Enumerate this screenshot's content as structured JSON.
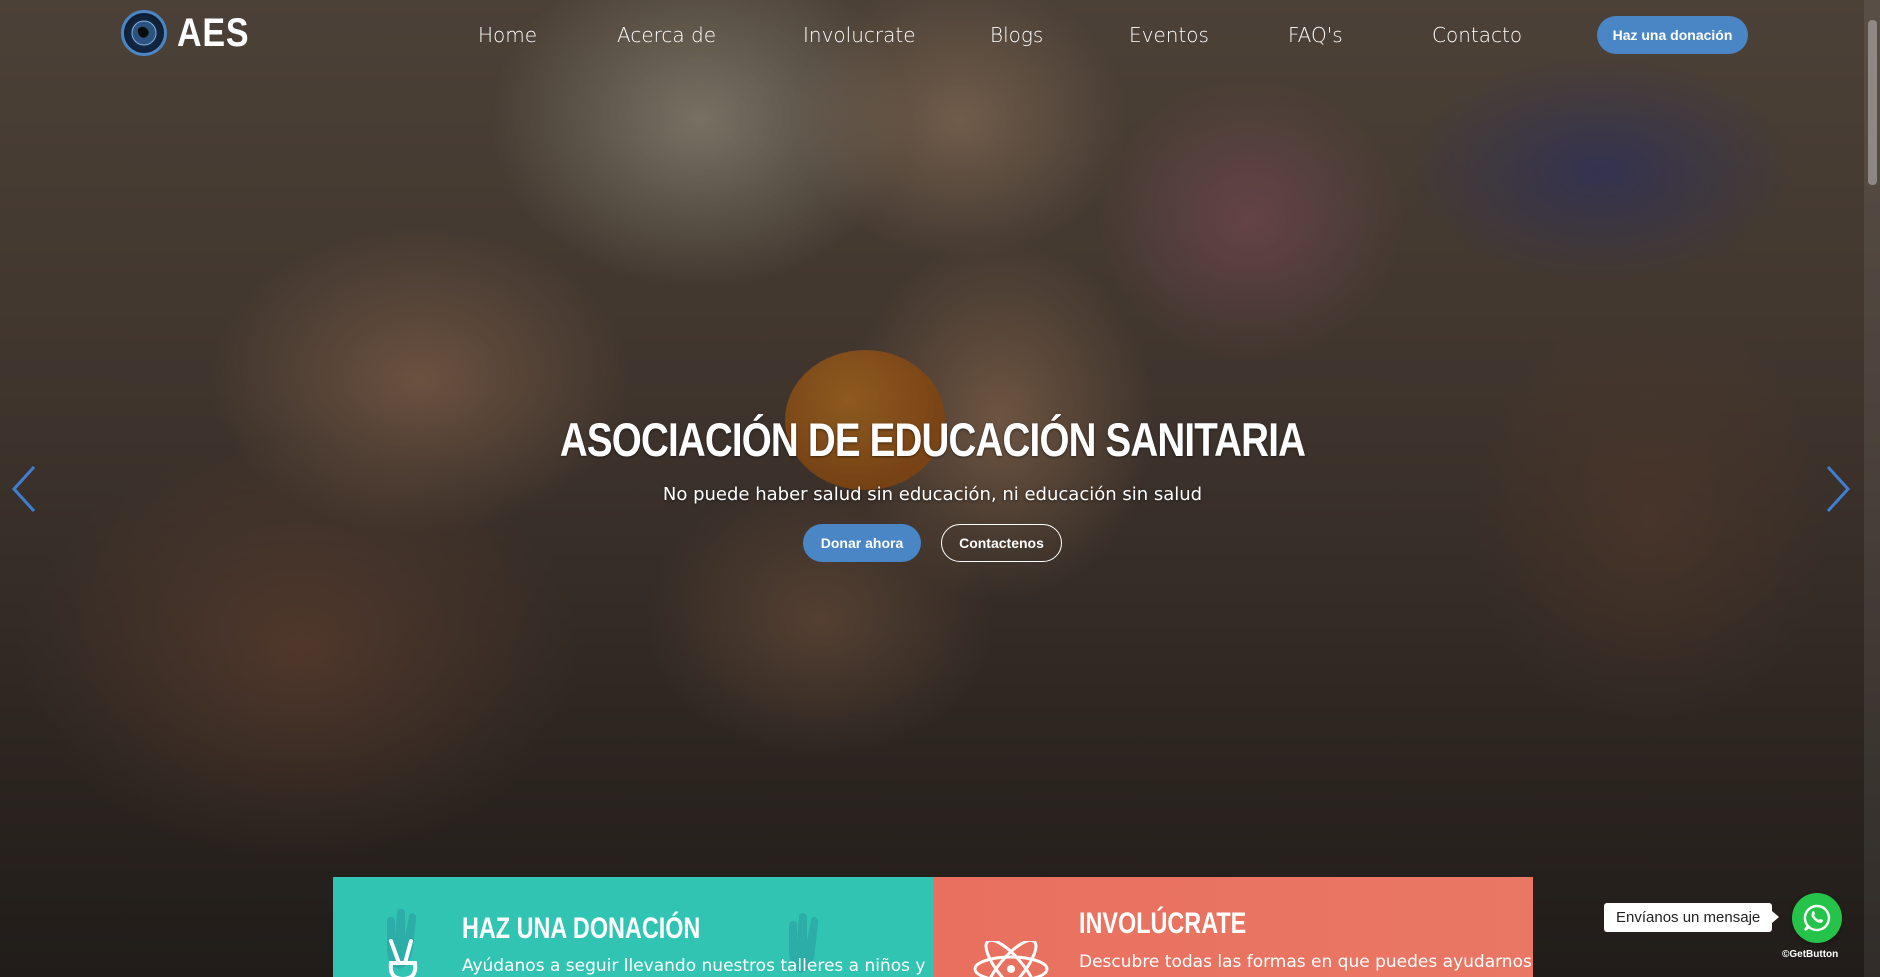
{
  "header": {
    "logo_text": "AES",
    "nav": [
      {
        "label": "Home",
        "active": true
      },
      {
        "label": "Acerca de"
      },
      {
        "label": "Involucrate"
      },
      {
        "label": "Blogs"
      },
      {
        "label": "Eventos"
      },
      {
        "label": "FAQ's"
      },
      {
        "label": "Contacto"
      }
    ],
    "donate_label": "Haz una donación"
  },
  "hero": {
    "title": "ASOCIACIÓN DE EDUCACIÓN SANITARIA",
    "subtitle": "No puede haber salud sin educación, ni educación sin salud",
    "primary_label": "Donar ahora",
    "secondary_label": "Contactenos"
  },
  "cards": [
    {
      "title": "HAZ UNA DONACIÓN",
      "text": "Ayúdanos a seguir llevando nuestros talleres a niños y",
      "color": "#31c4b3",
      "icon": "peace-hand-icon"
    },
    {
      "title": "INVOLÚCRATE",
      "text": "Descubre todas las formas en que puedes ayudarnos.",
      "color": "#e9705f",
      "icon": "atom-icon"
    }
  ],
  "whatsapp": {
    "bubble_text": "Envíanos un mensaje",
    "brand": "GetButton"
  },
  "colors": {
    "accent": "#4a86c5",
    "whatsapp": "#26c34a"
  }
}
